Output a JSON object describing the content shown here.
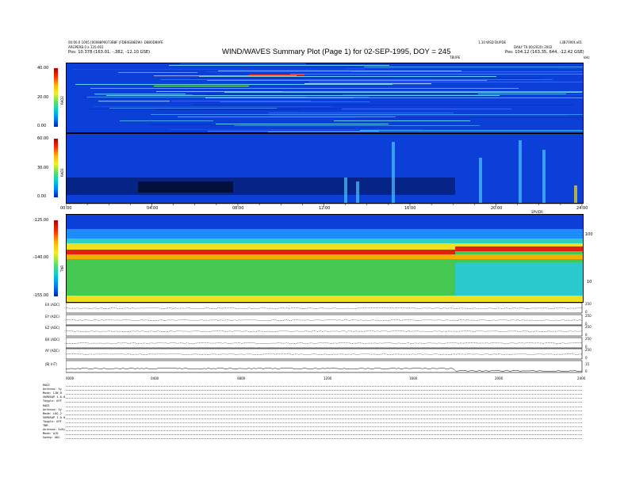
{
  "header": {
    "left_line1": "00:00.0 1005 [00088P0073B8F (FDB4GB8DW)- D8B0D89FE",
    "left_line2": "ARGPERB.0 a 135-001",
    "left_line3": "Pos:   10.378 (163.01, -.382, -12.10 GSE)",
    "right_line1": "1.10 WSD DUPDE",
    "right_line1b": "L3B7000t.a01",
    "right_line2": "DAILY T0.00(2020) 2002",
    "right_line3": "Pos:   104.12 (163.35, 644, -12.42 GSE)",
    "freq_unit_top": "kHz",
    "title_sub": "TBURE"
  },
  "title": "WIND/WAVES Summary Plot (Page 1) for 02-SEP-1995, DOY = 245",
  "panels": {
    "rad2": {
      "label": "RAD2",
      "ticks": [
        "40.00",
        "20.00",
        "0.00"
      ]
    },
    "rad1": {
      "label": "RAD1",
      "ticks": [
        "60.00",
        "30.00",
        "0.00"
      ]
    },
    "tnr": {
      "label": "TNR",
      "ticks": [
        "-125.00",
        "-140.00",
        "-155.00"
      ],
      "right_ticks": [
        "100",
        "10"
      ],
      "right_unit": "kHz"
    }
  },
  "time_axis": {
    "labels": [
      "00:00",
      "04:00",
      "08:00",
      "12:00",
      "16:00",
      "20:00",
      "24:00"
    ],
    "unit": "SPV/DR"
  },
  "bottom_axis": {
    "labels": [
      "0000",
      "0400",
      "0800",
      "1200",
      "1600",
      "2000",
      "2400"
    ]
  },
  "traces": [
    {
      "label": "EX (ADC)",
      "right_ticks": [
        "250",
        "0"
      ]
    },
    {
      "label": "EY (ADC)",
      "right_ticks": [
        "250",
        "0"
      ]
    },
    {
      "label": "EZ (ADC)",
      "right_ticks": [
        "250",
        "0"
      ]
    },
    {
      "label": "BX (ADC)",
      "right_ticks": [
        "250",
        "0"
      ]
    },
    {
      "label": "AY (ADC)",
      "right_ticks": [
        "250",
        "0"
      ]
    },
    {
      "label": "|B| (nT)",
      "right_ticks": [
        "15",
        "0"
      ]
    }
  ],
  "params": [
    "RAD2",
    "Antenna:     Sy",
    "Mode:    LIN_0",
    "SUMOSAP 1.0.0",
    "Toggle:      OFF",
    "RAD1",
    "Antenna:      Sy",
    "Mode:  LOG_2",
    "SUMOSAP 1.0.0",
    "Toggle:      OFF",
    "TNR",
    "Antenna:   ExEy",
    "Mode:       A/D",
    "Sweep:     ADL"
  ],
  "colors": {
    "background_blue": "#0b3fd8",
    "green": "#3ec85a",
    "red": "#e02010",
    "yellow": "#f0e020"
  }
}
